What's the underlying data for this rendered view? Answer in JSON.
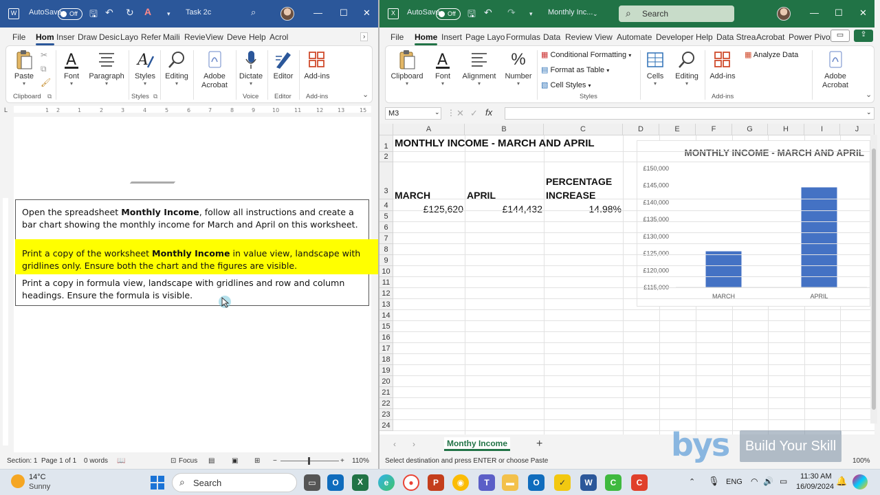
{
  "word": {
    "autosave": "AutoSave",
    "toggle": "Off",
    "doc_title": "Task 2c",
    "tabs": [
      "File",
      "Hom",
      "Inser",
      "Draw",
      "Desic",
      "Layo",
      "Refer",
      "Maili",
      "Revie",
      "View",
      "Deve",
      "Help",
      "Acrol"
    ],
    "ribbon": {
      "paste": "Paste",
      "font": "Font",
      "paragraph": "Paragraph",
      "styles": "Styles",
      "editing": "Editing",
      "adobe": "Adobe Acrobat",
      "dictate": "Dictate",
      "editor": "Editor",
      "addins": "Add-ins",
      "grp_clipboard": "Clipboard",
      "grp_styles": "Styles",
      "grp_voice": "Voice",
      "grp_editor": "Editor",
      "grp_addins": "Add-ins"
    },
    "para1_a": "Open the spreadsheet ",
    "para1_b": "Monthly Income",
    "para1_c": ", follow all instructions and create a bar chart showing the monthly income for March and April on this worksheet.",
    "para2_a": "Print a copy of the worksheet ",
    "para2_b": "Monthly Income",
    "para2_c": " in value view, landscape with gridlines only. Ensure both the chart and the figures are visible.",
    "para3": "Print a copy in formula view, landscape with gridlines and row and column headings. Ensure the formula is visible.",
    "status": {
      "section": "Section: 1",
      "page": "Page 1 of 1",
      "words": "0 words",
      "focus": "Focus",
      "zoom": "110%"
    }
  },
  "excel": {
    "autosave": "AutoSave",
    "toggle": "Off",
    "doc_title": "Monthly Inc...",
    "search": "Search",
    "tabs": [
      "File",
      "Home",
      "Insert",
      "Page Layo",
      "Formulas",
      "Data",
      "Review",
      "View",
      "Automate",
      "Developer",
      "Help",
      "Data Strea",
      "Acrobat",
      "Power Pivo"
    ],
    "ribbon": {
      "clipboard": "Clipboard",
      "font": "Font",
      "alignment": "Alignment",
      "number": "Number",
      "cond_format": "Conditional Formatting",
      "format_table": "Format as Table",
      "cell_styles": "Cell Styles",
      "cells": "Cells",
      "editing": "Editing",
      "addins": "Add-ins",
      "analyze": "Analyze Data",
      "adobe": "Adobe Acrobat",
      "grp_styles": "Styles",
      "grp_addins": "Add-ins"
    },
    "namebox": "M3",
    "columns": [
      "A",
      "B",
      "C",
      "D",
      "E",
      "F",
      "G",
      "H",
      "I",
      "J"
    ],
    "rows": [
      "1",
      "2",
      "3",
      "4",
      "5",
      "6",
      "7",
      "8",
      "9",
      "10",
      "11",
      "12",
      "13",
      "14",
      "15",
      "16",
      "17",
      "18",
      "19",
      "20",
      "21",
      "22",
      "23",
      "24"
    ],
    "cells": {
      "title": "MONTHLY INCOME - MARCH AND APRIL",
      "h_march": "MARCH",
      "h_april": "APRIL",
      "h_pct1": "PERCENTAGE",
      "h_pct2": "INCREASE",
      "v_march": "£125,620",
      "v_april": "£144,432",
      "v_pct": "14.98%"
    },
    "sheet_tab": "Monthy Income",
    "status": "Select destination and press ENTER or choose Paste",
    "zoom": "100%"
  },
  "chart_data": {
    "type": "bar",
    "title": "MONTHLY INCOME - MARCH AND APRIL",
    "categories": [
      "MARCH",
      "APRIL"
    ],
    "values": [
      125620,
      144432
    ],
    "ylim": [
      115000,
      150000
    ],
    "yticks": [
      115000,
      120000,
      125000,
      130000,
      135000,
      140000,
      145000,
      150000
    ],
    "ytick_labels": [
      "£115,000",
      "£120,000",
      "£125,000",
      "£130,000",
      "£135,000",
      "£140,000",
      "£145,000",
      "£150,000"
    ],
    "bar_color": "#4472c4",
    "legend": "none",
    "grid": false
  },
  "watermark": {
    "logo": "bys",
    "text": "Build Your Skill"
  },
  "taskbar": {
    "weather_temp": "14°C",
    "weather_desc": "Sunny",
    "search": "Search",
    "lang": "ENG",
    "time": "11:30 AM",
    "date": "16/09/2024"
  },
  "colors": {
    "word_brand": "#2b579a",
    "excel_brand": "#217346",
    "highlight": "#ffff00"
  }
}
